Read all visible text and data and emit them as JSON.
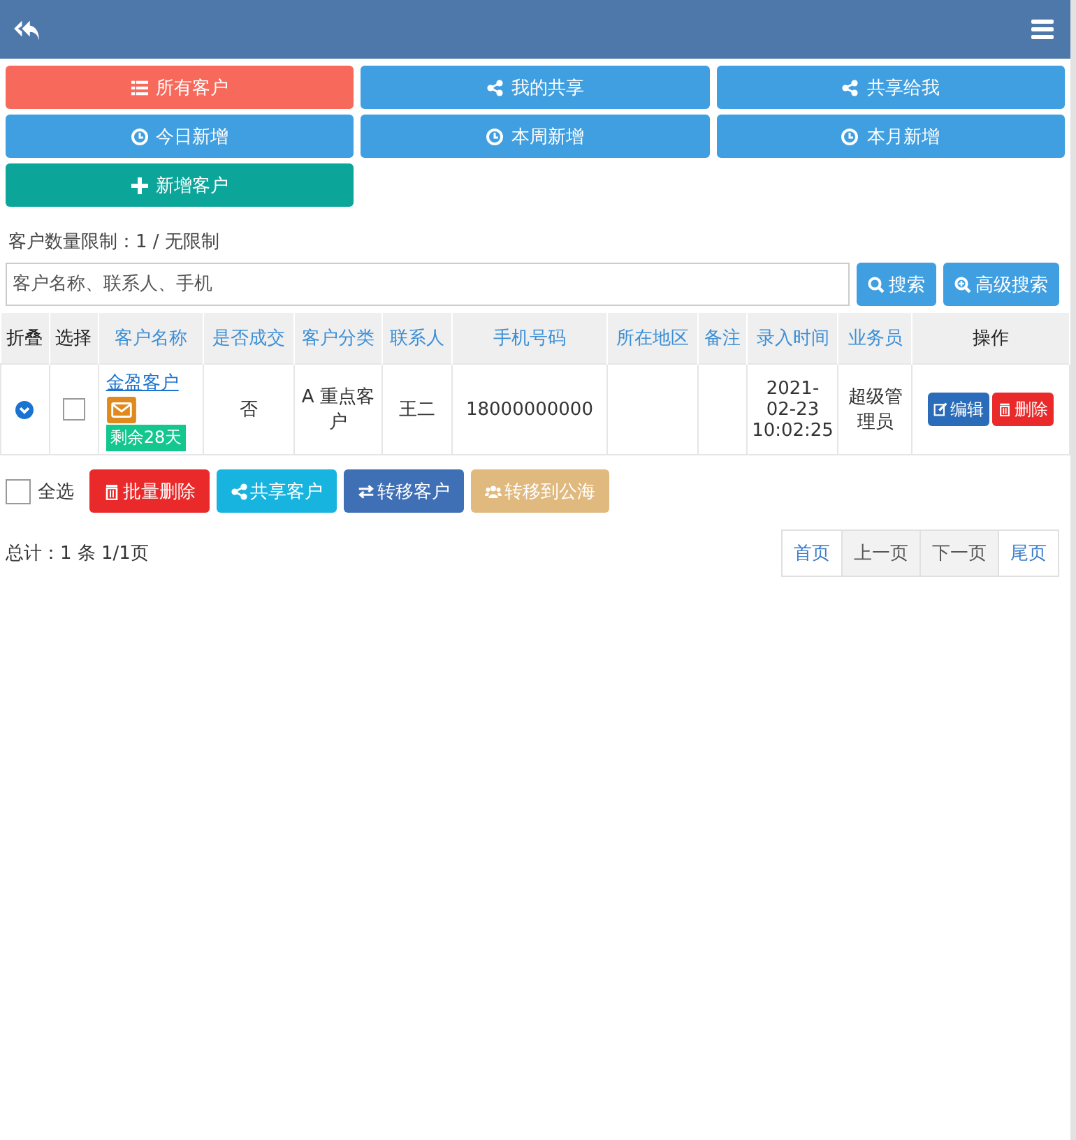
{
  "filters": [
    {
      "label": "所有客户",
      "kind": "list",
      "color": "#f76a5b"
    },
    {
      "label": "我的共享",
      "kind": "share",
      "color": "#409fe0"
    },
    {
      "label": "共享给我",
      "kind": "share",
      "color": "#409fe0"
    },
    {
      "label": "今日新增",
      "kind": "clock",
      "color": "#409fe0"
    },
    {
      "label": "本周新增",
      "kind": "clock",
      "color": "#409fe0"
    },
    {
      "label": "本月新增",
      "kind": "clock",
      "color": "#409fe0"
    },
    {
      "label": "新增客户",
      "kind": "plus",
      "color": "#0ca59a"
    }
  ],
  "limit_text": "客户数量限制：1 / 无限制",
  "search": {
    "placeholder": "客户名称、联系人、手机",
    "buttons": [
      {
        "label": "搜索",
        "kind": "search"
      },
      {
        "label": "高级搜索",
        "kind": "search-plus"
      }
    ]
  },
  "table": {
    "columns": [
      {
        "label": "折叠",
        "kind": "plain"
      },
      {
        "label": "选择",
        "kind": "plain"
      },
      {
        "label": "客户名称",
        "kind": "link"
      },
      {
        "label": "是否成交",
        "kind": "link"
      },
      {
        "label": "客户分类",
        "kind": "link"
      },
      {
        "label": "联系人",
        "kind": "link"
      },
      {
        "label": "手机号码",
        "kind": "link"
      },
      {
        "label": "所在地区",
        "kind": "link"
      },
      {
        "label": "备注",
        "kind": "link"
      },
      {
        "label": "录入时间",
        "kind": "link"
      },
      {
        "label": "业务员",
        "kind": "link"
      },
      {
        "label": "操作",
        "kind": "plain"
      }
    ],
    "rows": [
      {
        "checked": false,
        "name": "金盈客户",
        "badge": "剩余28天",
        "deal": "否",
        "category": "A 重点客户",
        "contact": "王二",
        "phone": "18000000000",
        "region": "",
        "note": "",
        "created": "2021-02-23 10:02:25",
        "salesman": "超级管理员",
        "actions": [
          {
            "label": "编辑",
            "kind": "edit"
          },
          {
            "label": "删除",
            "kind": "trash"
          }
        ]
      }
    ]
  },
  "select_all": {
    "label": "全选",
    "checked": false
  },
  "bulk_actions": [
    {
      "label": "批量删除",
      "kind": "trash",
      "color": "#ea2a2a"
    },
    {
      "label": "共享客户",
      "kind": "share",
      "color": "#18b4e0"
    },
    {
      "label": "转移客户",
      "kind": "exchange",
      "color": "#3f6fb5"
    },
    {
      "label": "转移到公海",
      "kind": "users",
      "color": "#e0b97f"
    }
  ],
  "total_text": "总计：1 条 1/1页",
  "pagination": [
    {
      "label": "首页",
      "disabled": false
    },
    {
      "label": "上一页",
      "disabled": true
    },
    {
      "label": "下一页",
      "disabled": true
    },
    {
      "label": "尾页",
      "disabled": false
    }
  ]
}
